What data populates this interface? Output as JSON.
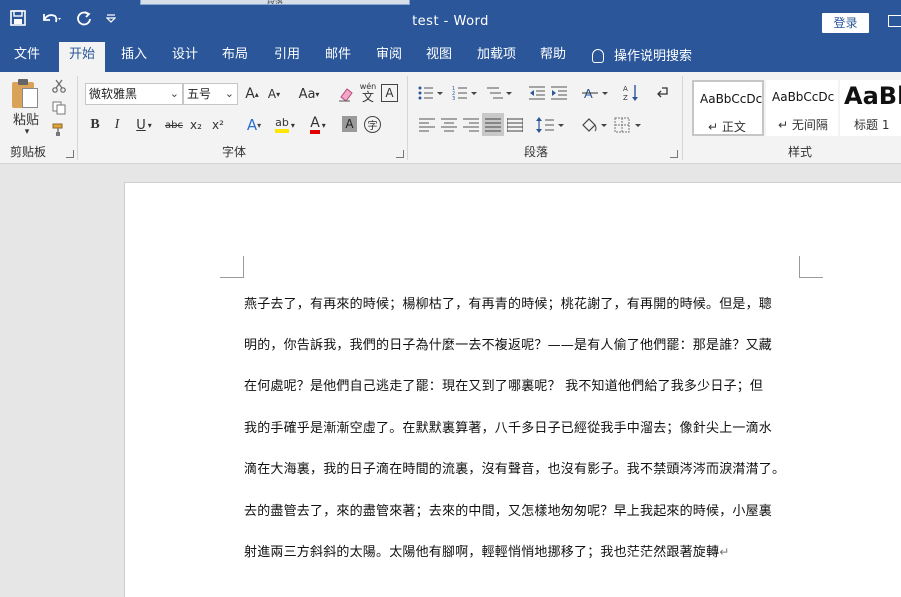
{
  "window": {
    "doc_title": "test  -  Word",
    "login_label": "登录",
    "ghost_tab_label": "段落"
  },
  "qat": {
    "save_icon": "save-icon",
    "undo_icon": "undo-icon",
    "redo_icon": "redo-icon",
    "customize_icon": "customize-qat-icon"
  },
  "tabs": [
    {
      "label": "文件"
    },
    {
      "label": "开始",
      "active": true
    },
    {
      "label": "插入"
    },
    {
      "label": "设计"
    },
    {
      "label": "布局"
    },
    {
      "label": "引用"
    },
    {
      "label": "邮件"
    },
    {
      "label": "审阅"
    },
    {
      "label": "视图"
    },
    {
      "label": "加载项"
    },
    {
      "label": "帮助"
    }
  ],
  "tell_me": "操作说明搜索",
  "ribbon": {
    "clipboard": {
      "label": "剪贴板",
      "paste_label": "粘贴"
    },
    "font": {
      "label": "字体",
      "font_name": "微软雅黑",
      "font_size": "五号",
      "grow": "A",
      "shrink": "A",
      "change_case": "Aa",
      "phonetic_top": "wén",
      "phonetic_bottom": "文",
      "char_border": "A",
      "bold": "B",
      "italic": "I",
      "underline": "U",
      "strike": "abc",
      "subscript": "x₂",
      "superscript": "x²",
      "text_effects": "A",
      "highlight": "ab",
      "font_color": "A",
      "char_shading": "A",
      "enclose": "字"
    },
    "paragraph": {
      "label": "段落"
    },
    "styles": {
      "label": "样式",
      "items": [
        {
          "sample": "AaBbCcDc",
          "name": "↵ 正文"
        },
        {
          "sample": "AaBbCcDc",
          "name": "↵ 无间隔"
        },
        {
          "sample": "AaBb",
          "name": "标题 1"
        }
      ]
    }
  },
  "colors": {
    "accent": "#2b579a",
    "highlight_yellow": "#ffe600",
    "font_red": "#e00000"
  },
  "document": {
    "lines": [
      "燕子去了，有再來的時候；楊柳枯了，有再青的時候；桃花謝了，有再開的時候。但是，聰",
      "明的，你告訴我，我們的日子為什麼一去不複返呢？——是有人偷了他們罷：那是誰？又藏",
      "在何處呢？是他們自己逃走了罷：現在又到了哪裏呢？  我不知道他們給了我多少日子；但",
      "我的手確乎是漸漸空虛了。在默默裏算著，八千多日子已經從我手中溜去；像針尖上一滴水",
      "滴在大海裏，我的日子滴在時間的流裏，沒有聲音，也沒有影子。我不禁頭涔涔而淚潸潸了。",
      "去的盡管去了，來的盡管來著；去來的中間，又怎樣地匆匆呢？早上我起來的時候，小屋裏",
      "射進兩三方斜斜的太陽。太陽他有腳啊，輕輕悄悄地挪移了；我也茫茫然跟著旋轉"
    ],
    "paragraph_mark": "↵"
  }
}
